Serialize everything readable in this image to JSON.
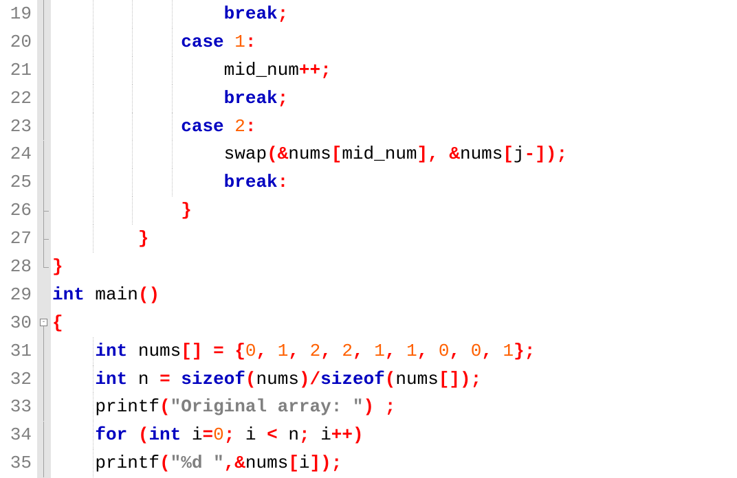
{
  "editor": {
    "first_line_number": 19,
    "line_height_px": 40.9,
    "colors": {
      "keyword": "#0000c0",
      "number": "#ff6000",
      "operator": "#ff0000",
      "bracket": "#ff0000",
      "identifier": "#000000",
      "string": "#808080",
      "gutter_text": "#808080",
      "fold_margin_bg": "#e4e4e4",
      "indent_guide": "#c0c0c0"
    },
    "lines": [
      {
        "num": 19,
        "fold": "line",
        "guides": [
          1,
          2,
          3
        ],
        "tokens": [
          {
            "t": "plain",
            "v": "                "
          },
          {
            "t": "kw",
            "v": "break"
          },
          {
            "t": "op",
            "v": ";"
          }
        ]
      },
      {
        "num": 20,
        "fold": "line",
        "guides": [
          1,
          2,
          3
        ],
        "tokens": [
          {
            "t": "plain",
            "v": "            "
          },
          {
            "t": "kw",
            "v": "case"
          },
          {
            "t": "plain",
            "v": " "
          },
          {
            "t": "num",
            "v": "1"
          },
          {
            "t": "op",
            "v": ":"
          }
        ]
      },
      {
        "num": 21,
        "fold": "line",
        "guides": [
          1,
          2,
          3
        ],
        "tokens": [
          {
            "t": "plain",
            "v": "                "
          },
          {
            "t": "id",
            "v": "mid_num"
          },
          {
            "t": "op",
            "v": "++;"
          }
        ]
      },
      {
        "num": 22,
        "fold": "line",
        "guides": [
          1,
          2,
          3
        ],
        "tokens": [
          {
            "t": "plain",
            "v": "                "
          },
          {
            "t": "kw",
            "v": "break"
          },
          {
            "t": "op",
            "v": ";"
          }
        ]
      },
      {
        "num": 23,
        "fold": "line",
        "guides": [
          1,
          2,
          3
        ],
        "tokens": [
          {
            "t": "plain",
            "v": "            "
          },
          {
            "t": "kw",
            "v": "case"
          },
          {
            "t": "plain",
            "v": " "
          },
          {
            "t": "num",
            "v": "2"
          },
          {
            "t": "op",
            "v": ":"
          }
        ]
      },
      {
        "num": 24,
        "fold": "line",
        "guides": [
          1,
          2,
          3
        ],
        "tokens": [
          {
            "t": "plain",
            "v": "                "
          },
          {
            "t": "id",
            "v": "swap"
          },
          {
            "t": "brk",
            "v": "("
          },
          {
            "t": "op",
            "v": "&"
          },
          {
            "t": "id",
            "v": "nums"
          },
          {
            "t": "brk",
            "v": "["
          },
          {
            "t": "id",
            "v": "mid_num"
          },
          {
            "t": "brk",
            "v": "]"
          },
          {
            "t": "op",
            "v": ","
          },
          {
            "t": "plain",
            "v": " "
          },
          {
            "t": "op",
            "v": "&"
          },
          {
            "t": "id",
            "v": "nums"
          },
          {
            "t": "brk",
            "v": "["
          },
          {
            "t": "id",
            "v": "j"
          },
          {
            "t": "op",
            "v": "-"
          },
          {
            "t": "brk",
            "v": "])"
          },
          {
            "t": "op",
            "v": ";"
          }
        ]
      },
      {
        "num": 25,
        "fold": "line",
        "guides": [
          1,
          2,
          3
        ],
        "tokens": [
          {
            "t": "plain",
            "v": "                "
          },
          {
            "t": "kw",
            "v": "break"
          },
          {
            "t": "op",
            "v": ":"
          }
        ]
      },
      {
        "num": 26,
        "fold": "tee",
        "guides": [
          1,
          2
        ],
        "tokens": [
          {
            "t": "plain",
            "v": "            "
          },
          {
            "t": "brk",
            "v": "}"
          }
        ]
      },
      {
        "num": 27,
        "fold": "tee",
        "guides": [
          1
        ],
        "tokens": [
          {
            "t": "plain",
            "v": "        "
          },
          {
            "t": "brk",
            "v": "}"
          }
        ]
      },
      {
        "num": 28,
        "fold": "end",
        "guides": [],
        "tokens": [
          {
            "t": "brk",
            "v": "}"
          }
        ]
      },
      {
        "num": 29,
        "fold": "none",
        "guides": [],
        "tokens": [
          {
            "t": "kw",
            "v": "int"
          },
          {
            "t": "plain",
            "v": " "
          },
          {
            "t": "id",
            "v": "main"
          },
          {
            "t": "brk",
            "v": "()"
          }
        ]
      },
      {
        "num": 30,
        "fold": "box",
        "guides": [],
        "tokens": [
          {
            "t": "brk",
            "v": "{"
          }
        ]
      },
      {
        "num": 31,
        "fold": "line",
        "guides": [
          1
        ],
        "tokens": [
          {
            "t": "plain",
            "v": "    "
          },
          {
            "t": "kw",
            "v": "int"
          },
          {
            "t": "plain",
            "v": " "
          },
          {
            "t": "id",
            "v": "nums"
          },
          {
            "t": "brk",
            "v": "[]"
          },
          {
            "t": "plain",
            "v": " "
          },
          {
            "t": "op",
            "v": "="
          },
          {
            "t": "plain",
            "v": " "
          },
          {
            "t": "brk",
            "v": "{"
          },
          {
            "t": "num",
            "v": "0"
          },
          {
            "t": "op",
            "v": ","
          },
          {
            "t": "plain",
            "v": " "
          },
          {
            "t": "num",
            "v": "1"
          },
          {
            "t": "op",
            "v": ","
          },
          {
            "t": "plain",
            "v": " "
          },
          {
            "t": "num",
            "v": "2"
          },
          {
            "t": "op",
            "v": ","
          },
          {
            "t": "plain",
            "v": " "
          },
          {
            "t": "num",
            "v": "2"
          },
          {
            "t": "op",
            "v": ","
          },
          {
            "t": "plain",
            "v": " "
          },
          {
            "t": "num",
            "v": "1"
          },
          {
            "t": "op",
            "v": ","
          },
          {
            "t": "plain",
            "v": " "
          },
          {
            "t": "num",
            "v": "1"
          },
          {
            "t": "op",
            "v": ","
          },
          {
            "t": "plain",
            "v": " "
          },
          {
            "t": "num",
            "v": "0"
          },
          {
            "t": "op",
            "v": ","
          },
          {
            "t": "plain",
            "v": " "
          },
          {
            "t": "num",
            "v": "0"
          },
          {
            "t": "op",
            "v": ","
          },
          {
            "t": "plain",
            "v": " "
          },
          {
            "t": "num",
            "v": "1"
          },
          {
            "t": "brk",
            "v": "}"
          },
          {
            "t": "op",
            "v": ";"
          }
        ]
      },
      {
        "num": 32,
        "fold": "line",
        "guides": [
          1
        ],
        "tokens": [
          {
            "t": "plain",
            "v": "    "
          },
          {
            "t": "kw",
            "v": "int"
          },
          {
            "t": "plain",
            "v": " "
          },
          {
            "t": "id",
            "v": "n "
          },
          {
            "t": "op",
            "v": "="
          },
          {
            "t": "plain",
            "v": " "
          },
          {
            "t": "kw",
            "v": "sizeof"
          },
          {
            "t": "brk",
            "v": "("
          },
          {
            "t": "id",
            "v": "nums"
          },
          {
            "t": "brk",
            "v": ")"
          },
          {
            "t": "op",
            "v": "/"
          },
          {
            "t": "kw",
            "v": "sizeof"
          },
          {
            "t": "brk",
            "v": "("
          },
          {
            "t": "id",
            "v": "nums"
          },
          {
            "t": "brk",
            "v": "[])"
          },
          {
            "t": "op",
            "v": ";"
          }
        ]
      },
      {
        "num": 33,
        "fold": "line",
        "guides": [
          1
        ],
        "tokens": [
          {
            "t": "plain",
            "v": "    "
          },
          {
            "t": "id",
            "v": "printf"
          },
          {
            "t": "brk",
            "v": "("
          },
          {
            "t": "str",
            "v": "\"Original array: \""
          },
          {
            "t": "brk",
            "v": ")"
          },
          {
            "t": "plain",
            "v": " "
          },
          {
            "t": "op",
            "v": ";"
          }
        ]
      },
      {
        "num": 34,
        "fold": "line",
        "guides": [
          1
        ],
        "tokens": [
          {
            "t": "plain",
            "v": "    "
          },
          {
            "t": "kw",
            "v": "for"
          },
          {
            "t": "plain",
            "v": " "
          },
          {
            "t": "brk",
            "v": "("
          },
          {
            "t": "kw",
            "v": "int"
          },
          {
            "t": "plain",
            "v": " "
          },
          {
            "t": "id",
            "v": "i"
          },
          {
            "t": "op",
            "v": "="
          },
          {
            "t": "num",
            "v": "0"
          },
          {
            "t": "op",
            "v": ";"
          },
          {
            "t": "plain",
            "v": " "
          },
          {
            "t": "id",
            "v": "i "
          },
          {
            "t": "op",
            "v": "<"
          },
          {
            "t": "plain",
            "v": " "
          },
          {
            "t": "id",
            "v": "n"
          },
          {
            "t": "op",
            "v": ";"
          },
          {
            "t": "plain",
            "v": " "
          },
          {
            "t": "id",
            "v": "i"
          },
          {
            "t": "op",
            "v": "++"
          },
          {
            "t": "brk",
            "v": ")"
          }
        ]
      },
      {
        "num": 35,
        "fold": "line",
        "guides": [
          1
        ],
        "tokens": [
          {
            "t": "plain",
            "v": "    "
          },
          {
            "t": "id",
            "v": "printf"
          },
          {
            "t": "brk",
            "v": "("
          },
          {
            "t": "str",
            "v": "\"%d \""
          },
          {
            "t": "op",
            "v": ",&"
          },
          {
            "t": "id",
            "v": "nums"
          },
          {
            "t": "brk",
            "v": "["
          },
          {
            "t": "id",
            "v": "i"
          },
          {
            "t": "brk",
            "v": "])"
          },
          {
            "t": "op",
            "v": ";"
          }
        ]
      }
    ]
  }
}
